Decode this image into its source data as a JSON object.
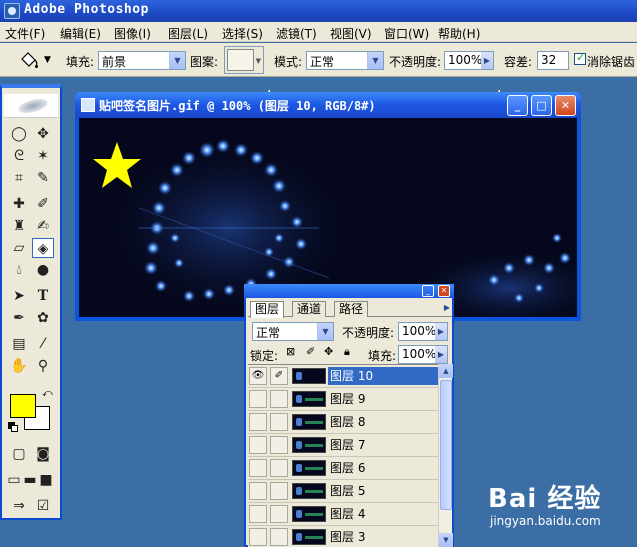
{
  "app": {
    "title": "Adobe Photoshop"
  },
  "menu": [
    "文件(F)",
    "编辑(E)",
    "图像(I)",
    "图层(L)",
    "选择(S)",
    "滤镜(T)",
    "视图(V)",
    "窗口(W)",
    "帮助(H)"
  ],
  "options": {
    "fill_label": "填充:",
    "fill_value": "前景",
    "pattern_label": "图案:",
    "mode_label": "模式:",
    "mode_value": "正常",
    "opacity_label": "不透明度:",
    "opacity_value": "100%",
    "tolerance_label": "容差:",
    "tolerance_value": "32",
    "antialias_label": "消除锯齿"
  },
  "document": {
    "title": "贴吧签名图片.gif @ 100% (图层 10, RGB/8#)"
  },
  "layers_panel": {
    "tabs": [
      "图层",
      "通道",
      "路径"
    ],
    "blend_mode": "正常",
    "opacity_label": "不透明度:",
    "opacity_value": "100%",
    "lock_label": "锁定:",
    "fill_label": "填充:",
    "fill_value": "100%",
    "layers": [
      "图层 10",
      "图层 9",
      "图层 8",
      "图层 7",
      "图层 6",
      "图层 5",
      "图层 4",
      "图层 3"
    ]
  },
  "colors": {
    "foreground": "#ffff00",
    "background": "#ffffff",
    "xp_blue": "#0a4bd1",
    "selection": "#316ac5"
  },
  "watermark": {
    "logo": "Bai 经验",
    "url": "jingyan.baidu.com"
  }
}
